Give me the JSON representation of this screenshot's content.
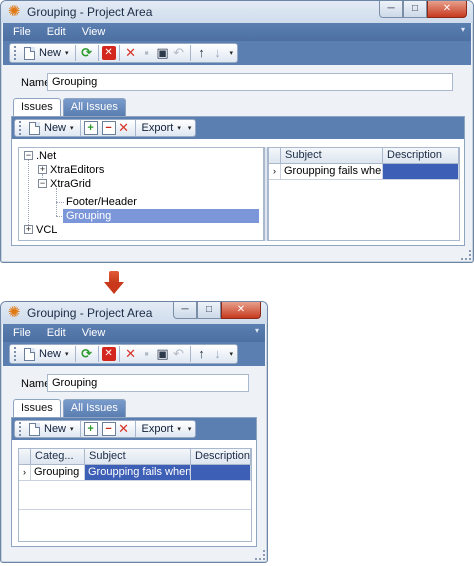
{
  "window": {
    "title": "Grouping - Project Area",
    "min_glyph": "─",
    "max_glyph": "□",
    "close_glyph": "✕"
  },
  "menu": [
    "File",
    "Edit",
    "View"
  ],
  "menu_arrow": "▾",
  "toolbar": {
    "new_label": "New",
    "caret": "▾"
  },
  "name": {
    "label": "Name",
    "value": "Grouping"
  },
  "tabs": [
    "Issues",
    "All Issues"
  ],
  "subtoolbar": {
    "new_label": "New",
    "export_label": "Export",
    "caret": "▾"
  },
  "tree": {
    "nodes": [
      {
        "label": ".Net",
        "expander": "−"
      },
      {
        "label": "XtraEditors",
        "expander": "+"
      },
      {
        "label": "XtraGrid",
        "expander": "−"
      },
      {
        "label": "Footer/Header",
        "expander": ""
      },
      {
        "label": "Grouping",
        "expander": "",
        "selected": true
      },
      {
        "label": "VCL",
        "expander": "+"
      }
    ]
  },
  "grid1": {
    "columns": [
      "Subject",
      "Description"
    ],
    "rows": [
      {
        "indicator": "›",
        "subject": "Groupping fails when ...",
        "description": ""
      }
    ]
  },
  "grid2": {
    "columns": [
      "Categ...",
      "Subject",
      "Description"
    ],
    "rows": [
      {
        "indicator": "›",
        "category": "Grouping",
        "subject": "Groupping fails when ...",
        "description": ""
      }
    ]
  },
  "colors": {
    "accent": "#5b7fb1",
    "selection": "#3d5fb6",
    "tree_selection": "#7b96d9",
    "arrow": "#c9381a"
  },
  "icons": {
    "app": "gear-icon",
    "refresh": "refresh-icon",
    "delete": "delete-icon",
    "cancel": "cross-icon",
    "save": "save-icon",
    "undo": "undo-icon",
    "up": "arrow-up-icon",
    "down": "arrow-down-icon",
    "add_record": "add-record-icon",
    "remove_record": "remove-record-icon",
    "transition": "arrow-down-icon"
  }
}
